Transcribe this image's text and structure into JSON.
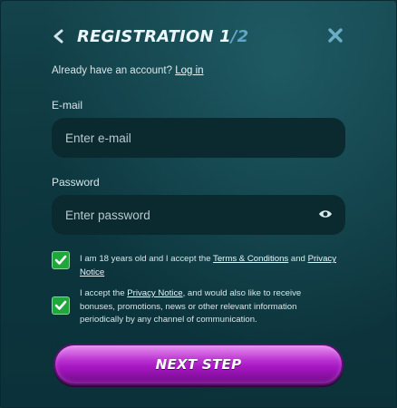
{
  "header": {
    "title": "REGISTRATION 1",
    "step_sep": "/",
    "step_total": "2",
    "back_icon": "chevron-left-icon",
    "close_icon": "close-icon"
  },
  "account": {
    "prompt": "Already have an account?",
    "login_link": "Log in"
  },
  "form": {
    "email": {
      "label": "E-mail",
      "placeholder": "Enter e-mail",
      "value": ""
    },
    "password": {
      "label": "Password",
      "placeholder": "Enter password",
      "value": "",
      "toggle_icon": "eye-icon"
    }
  },
  "consents": [
    {
      "checked": true,
      "text_before": "I am 18 years old and I accept the ",
      "link1": "Terms & Conditions",
      "text_mid": " and ",
      "link2": "Privacy Notice"
    },
    {
      "checked": true,
      "text_before": "I accept the ",
      "link1": "Privacy Notice",
      "text_after": ", and would also like to receive bonuses, promotions, news or other relevant information periodically by any channel of communication."
    }
  ],
  "submit": {
    "label": "NEXT STEP"
  },
  "colors": {
    "accent_purple": "#a716c3",
    "checkbox_green": "#1ea83a",
    "panel_bg": "#14434b"
  }
}
